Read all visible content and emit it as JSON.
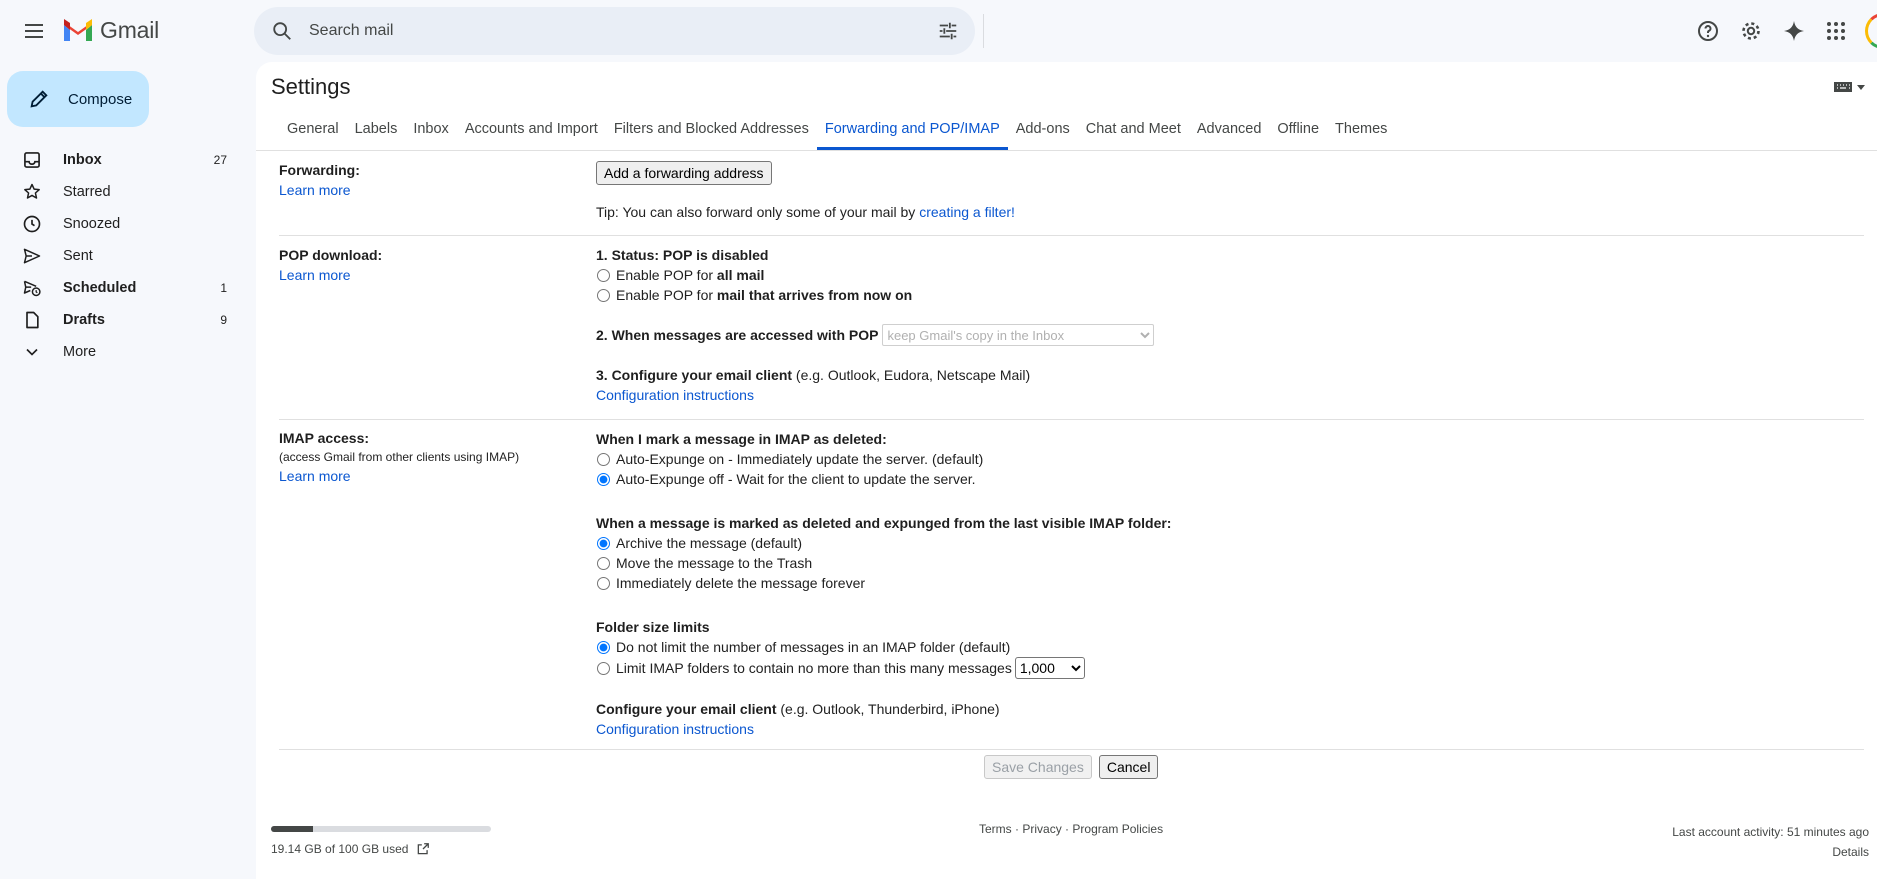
{
  "app": {
    "name": "Gmail"
  },
  "search": {
    "placeholder": "Search mail"
  },
  "compose": {
    "label": "Compose"
  },
  "nav": {
    "items": [
      {
        "label": "Inbox",
        "count": "27"
      },
      {
        "label": "Starred",
        "count": ""
      },
      {
        "label": "Snoozed",
        "count": ""
      },
      {
        "label": "Sent",
        "count": ""
      },
      {
        "label": "Scheduled",
        "count": "1"
      },
      {
        "label": "Drafts",
        "count": "9"
      },
      {
        "label": "More",
        "count": ""
      }
    ]
  },
  "settings": {
    "title": "Settings",
    "tabs": [
      "General",
      "Labels",
      "Inbox",
      "Accounts and Import",
      "Filters and Blocked Addresses",
      "Forwarding and POP/IMAP",
      "Add-ons",
      "Chat and Meet",
      "Advanced",
      "Offline",
      "Themes"
    ],
    "active_tab": "Forwarding and POP/IMAP"
  },
  "forwarding": {
    "label": "Forwarding:",
    "learn_more": "Learn more",
    "add_button": "Add a forwarding address",
    "tip_prefix": "Tip: You can also forward only some of your mail by ",
    "tip_link": "creating a filter!"
  },
  "pop": {
    "label": "POP download:",
    "learn_more": "Learn more",
    "status": "1. Status: POP is disabled",
    "opt1_prefix": "Enable POP for ",
    "opt1_bold": "all mail",
    "opt2_prefix": "Enable POP for ",
    "opt2_bold": "mail that arrives from now on",
    "access_label": "2. When messages are accessed with POP",
    "access_select": "keep Gmail's copy in the Inbox",
    "configure_bold": "3. Configure your email client",
    "configure_rest": " (e.g. Outlook, Eudora, Netscape Mail)",
    "config_link": "Configuration instructions"
  },
  "imap": {
    "label": "IMAP access:",
    "sublabel": "(access Gmail from other clients using IMAP)",
    "learn_more": "Learn more",
    "deleted_heading": "When I mark a message in IMAP as deleted:",
    "deleted_opt1": "Auto-Expunge on - Immediately update the server. (default)",
    "deleted_opt2": "Auto-Expunge off - Wait for the client to update the server.",
    "expunged_heading": "When a message is marked as deleted and expunged from the last visible IMAP folder:",
    "expunged_opt1": "Archive the message (default)",
    "expunged_opt2": "Move the message to the Trash",
    "expunged_opt3": "Immediately delete the message forever",
    "folder_heading": "Folder size limits",
    "folder_opt1": "Do not limit the number of messages in an IMAP folder (default)",
    "folder_opt2": "Limit IMAP folders to contain no more than this many messages",
    "folder_limit": "1,000",
    "configure_bold": "Configure your email client",
    "configure_rest": " (e.g. Outlook, Thunderbird, iPhone)",
    "config_link": "Configuration instructions"
  },
  "actions": {
    "save": "Save Changes",
    "cancel": "Cancel"
  },
  "footer": {
    "storage": "19.14 GB of 100 GB used",
    "storage_fraction": 0.19,
    "terms": "Terms",
    "privacy": "Privacy",
    "policies": "Program Policies",
    "activity": "Last account activity: 51 minutes ago",
    "details": "Details"
  }
}
